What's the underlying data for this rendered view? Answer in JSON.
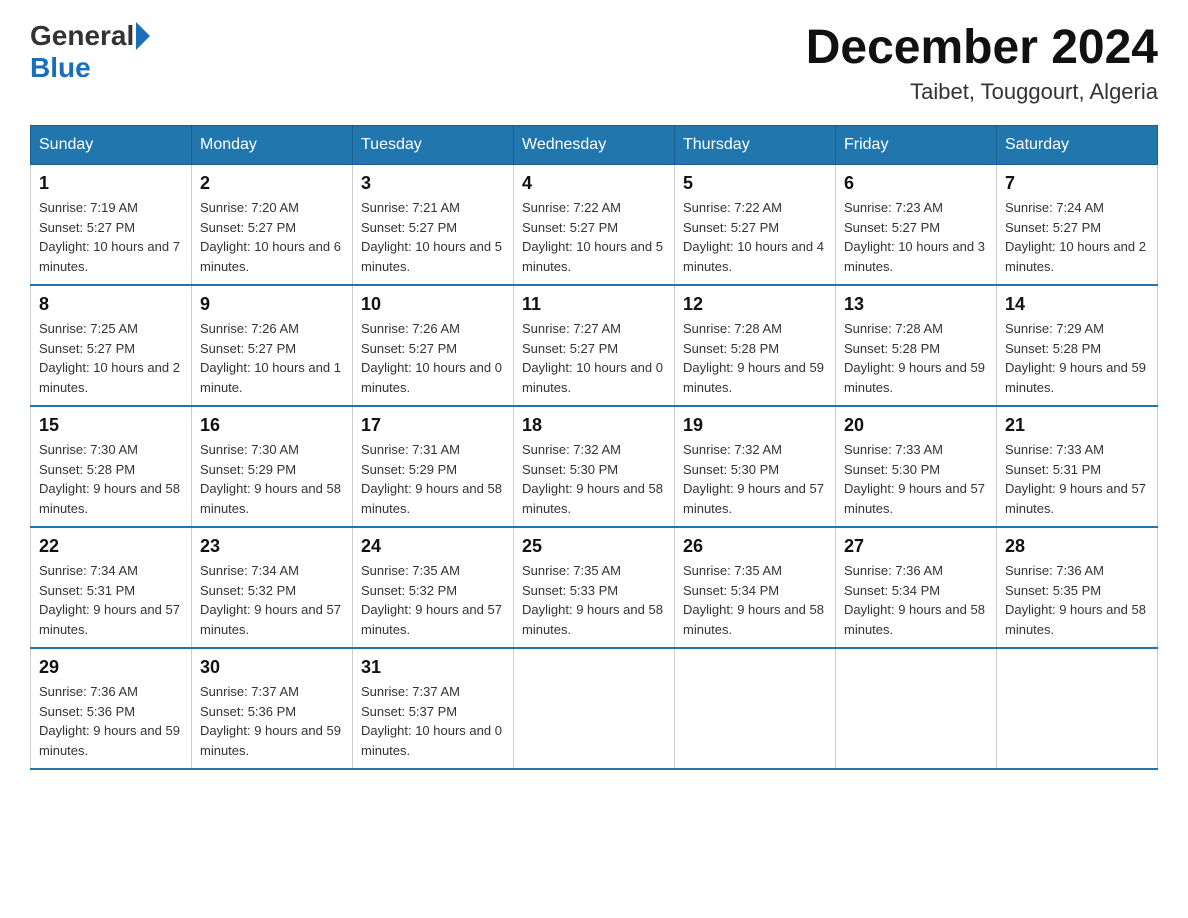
{
  "header": {
    "logo_general": "General",
    "logo_blue": "Blue",
    "month_title": "December 2024",
    "location": "Taibet, Touggourt, Algeria"
  },
  "days_of_week": [
    "Sunday",
    "Monday",
    "Tuesday",
    "Wednesday",
    "Thursday",
    "Friday",
    "Saturday"
  ],
  "weeks": [
    [
      {
        "day": "1",
        "sunrise": "7:19 AM",
        "sunset": "5:27 PM",
        "daylight": "10 hours and 7 minutes."
      },
      {
        "day": "2",
        "sunrise": "7:20 AM",
        "sunset": "5:27 PM",
        "daylight": "10 hours and 6 minutes."
      },
      {
        "day": "3",
        "sunrise": "7:21 AM",
        "sunset": "5:27 PM",
        "daylight": "10 hours and 5 minutes."
      },
      {
        "day": "4",
        "sunrise": "7:22 AM",
        "sunset": "5:27 PM",
        "daylight": "10 hours and 5 minutes."
      },
      {
        "day": "5",
        "sunrise": "7:22 AM",
        "sunset": "5:27 PM",
        "daylight": "10 hours and 4 minutes."
      },
      {
        "day": "6",
        "sunrise": "7:23 AM",
        "sunset": "5:27 PM",
        "daylight": "10 hours and 3 minutes."
      },
      {
        "day": "7",
        "sunrise": "7:24 AM",
        "sunset": "5:27 PM",
        "daylight": "10 hours and 2 minutes."
      }
    ],
    [
      {
        "day": "8",
        "sunrise": "7:25 AM",
        "sunset": "5:27 PM",
        "daylight": "10 hours and 2 minutes."
      },
      {
        "day": "9",
        "sunrise": "7:26 AM",
        "sunset": "5:27 PM",
        "daylight": "10 hours and 1 minute."
      },
      {
        "day": "10",
        "sunrise": "7:26 AM",
        "sunset": "5:27 PM",
        "daylight": "10 hours and 0 minutes."
      },
      {
        "day": "11",
        "sunrise": "7:27 AM",
        "sunset": "5:27 PM",
        "daylight": "10 hours and 0 minutes."
      },
      {
        "day": "12",
        "sunrise": "7:28 AM",
        "sunset": "5:28 PM",
        "daylight": "9 hours and 59 minutes."
      },
      {
        "day": "13",
        "sunrise": "7:28 AM",
        "sunset": "5:28 PM",
        "daylight": "9 hours and 59 minutes."
      },
      {
        "day": "14",
        "sunrise": "7:29 AM",
        "sunset": "5:28 PM",
        "daylight": "9 hours and 59 minutes."
      }
    ],
    [
      {
        "day": "15",
        "sunrise": "7:30 AM",
        "sunset": "5:28 PM",
        "daylight": "9 hours and 58 minutes."
      },
      {
        "day": "16",
        "sunrise": "7:30 AM",
        "sunset": "5:29 PM",
        "daylight": "9 hours and 58 minutes."
      },
      {
        "day": "17",
        "sunrise": "7:31 AM",
        "sunset": "5:29 PM",
        "daylight": "9 hours and 58 minutes."
      },
      {
        "day": "18",
        "sunrise": "7:32 AM",
        "sunset": "5:30 PM",
        "daylight": "9 hours and 58 minutes."
      },
      {
        "day": "19",
        "sunrise": "7:32 AM",
        "sunset": "5:30 PM",
        "daylight": "9 hours and 57 minutes."
      },
      {
        "day": "20",
        "sunrise": "7:33 AM",
        "sunset": "5:30 PM",
        "daylight": "9 hours and 57 minutes."
      },
      {
        "day": "21",
        "sunrise": "7:33 AM",
        "sunset": "5:31 PM",
        "daylight": "9 hours and 57 minutes."
      }
    ],
    [
      {
        "day": "22",
        "sunrise": "7:34 AM",
        "sunset": "5:31 PM",
        "daylight": "9 hours and 57 minutes."
      },
      {
        "day": "23",
        "sunrise": "7:34 AM",
        "sunset": "5:32 PM",
        "daylight": "9 hours and 57 minutes."
      },
      {
        "day": "24",
        "sunrise": "7:35 AM",
        "sunset": "5:32 PM",
        "daylight": "9 hours and 57 minutes."
      },
      {
        "day": "25",
        "sunrise": "7:35 AM",
        "sunset": "5:33 PM",
        "daylight": "9 hours and 58 minutes."
      },
      {
        "day": "26",
        "sunrise": "7:35 AM",
        "sunset": "5:34 PM",
        "daylight": "9 hours and 58 minutes."
      },
      {
        "day": "27",
        "sunrise": "7:36 AM",
        "sunset": "5:34 PM",
        "daylight": "9 hours and 58 minutes."
      },
      {
        "day": "28",
        "sunrise": "7:36 AM",
        "sunset": "5:35 PM",
        "daylight": "9 hours and 58 minutes."
      }
    ],
    [
      {
        "day": "29",
        "sunrise": "7:36 AM",
        "sunset": "5:36 PM",
        "daylight": "9 hours and 59 minutes."
      },
      {
        "day": "30",
        "sunrise": "7:37 AM",
        "sunset": "5:36 PM",
        "daylight": "9 hours and 59 minutes."
      },
      {
        "day": "31",
        "sunrise": "7:37 AM",
        "sunset": "5:37 PM",
        "daylight": "10 hours and 0 minutes."
      },
      null,
      null,
      null,
      null
    ]
  ],
  "labels": {
    "sunrise": "Sunrise:",
    "sunset": "Sunset:",
    "daylight": "Daylight:"
  }
}
